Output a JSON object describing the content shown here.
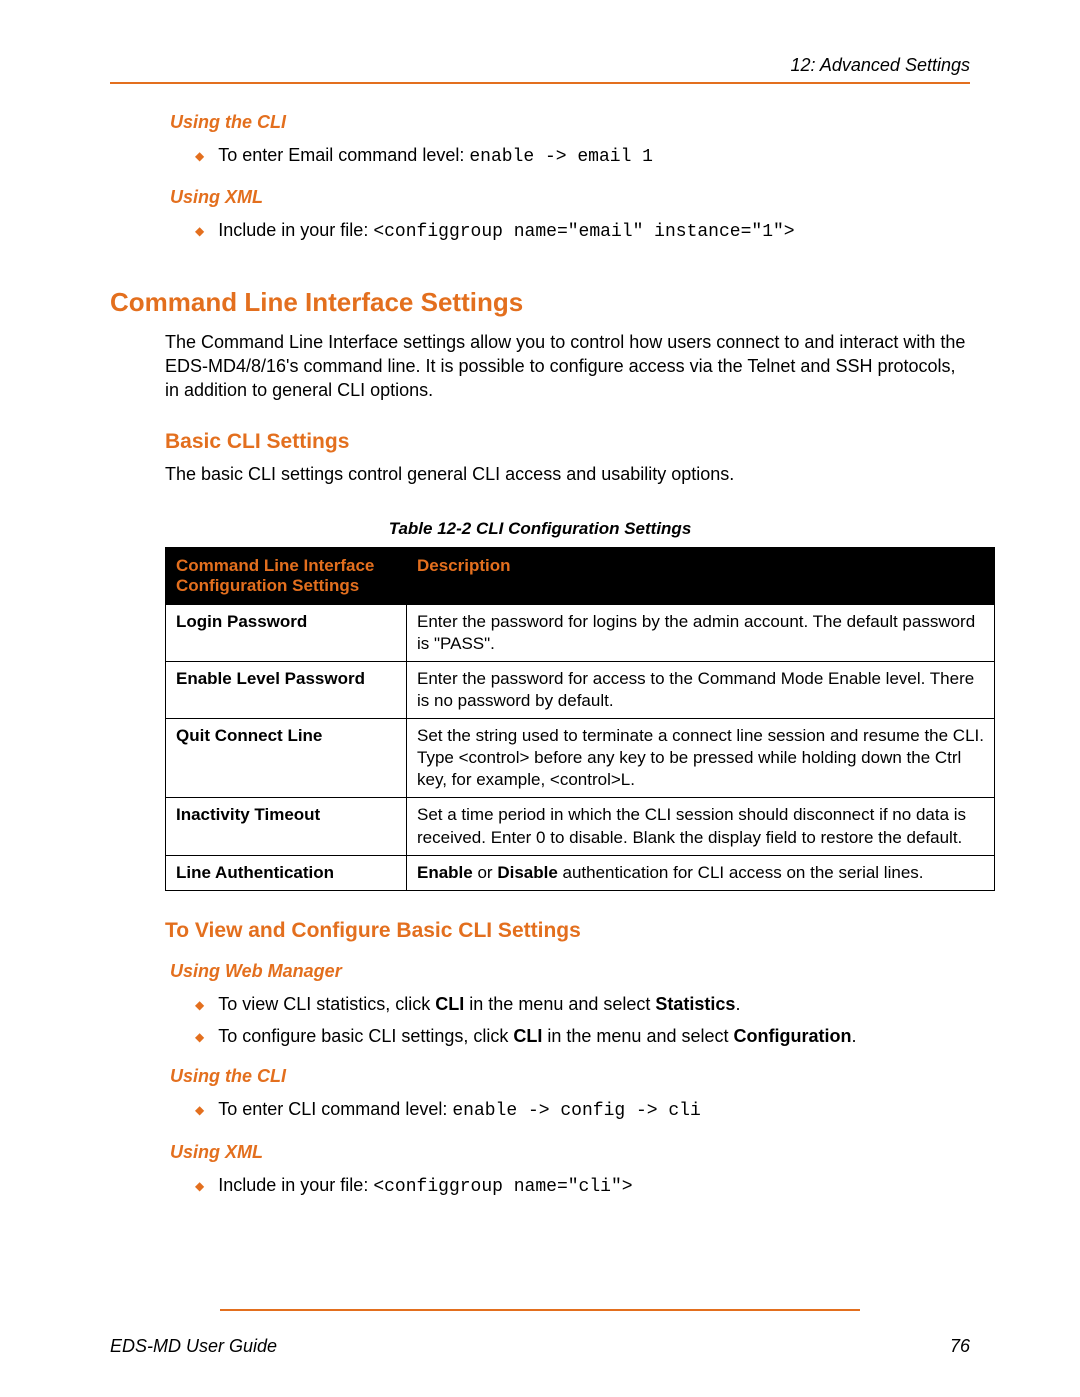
{
  "chapter_header": "12: Advanced Settings",
  "s1": {
    "cli_h": "Using the CLI",
    "cli_b1a": "To enter Email command level: ",
    "cli_b1b": "enable -> email 1",
    "xml_h": "Using XML",
    "xml_b1a": "Include in your file: ",
    "xml_b1b": "<configgroup name=\"email\" instance=\"1\">"
  },
  "h1": "Command Line Interface Settings",
  "p1": "The Command Line Interface settings allow you to control how users connect to and interact with the EDS-MD4/8/16's command line. It is possible to configure access via the Telnet and SSH protocols, in addition to general CLI options.",
  "h2": "Basic CLI Settings",
  "p2": "The basic CLI settings control general CLI access and usability options.",
  "table": {
    "caption": "Table 12-2  CLI Configuration Settings",
    "th1": "Command Line Interface Configuration Settings",
    "th2": "Description",
    "r1c1": "Login Password",
    "r1c2": "Enter the password for logins by the admin account.  The default password is \"PASS\".",
    "r2c1": "Enable Level Password",
    "r2c2": "Enter the password for access to the Command Mode Enable level. There is no password by default.",
    "r3c1": "Quit Connect Line",
    "r3c2": "Set the string used to terminate a connect line session and resume the CLI. Type <control> before any key to be pressed while holding down the Ctrl key, for example, <control>L.",
    "r4c1": "Inactivity Timeout",
    "r4c2": "Set a time period in which the CLI session should disconnect if no data is received.  Enter 0 to disable. Blank the display field to restore the default.",
    "r5c1": "Line Authentication",
    "r5c2a": "Enable",
    "r5c2b": " or ",
    "r5c2c": "Disable",
    "r5c2d": " authentication for CLI access on the serial lines."
  },
  "h3": "To View and Configure Basic CLI Settings",
  "s2": {
    "web_h": "Using Web Manager",
    "web_b1a": "To view CLI statistics, click ",
    "web_b1b": "CLI",
    "web_b1c": " in the menu and select ",
    "web_b1d": "Statistics",
    "web_b1e": ".",
    "web_b2a": "To configure basic CLI settings, click ",
    "web_b2b": "CLI",
    "web_b2c": " in the menu and select ",
    "web_b2d": "Configuration",
    "web_b2e": ".",
    "cli_h": "Using the CLI",
    "cli_b1a": "To enter CLI command level: ",
    "cli_b1b": "enable -> config -> cli",
    "xml_h": "Using XML",
    "xml_b1a": "Include in your file: ",
    "xml_b1b": "<configgroup name=\"cli\">"
  },
  "footer": {
    "left": "EDS-MD User Guide",
    "right": "76"
  }
}
